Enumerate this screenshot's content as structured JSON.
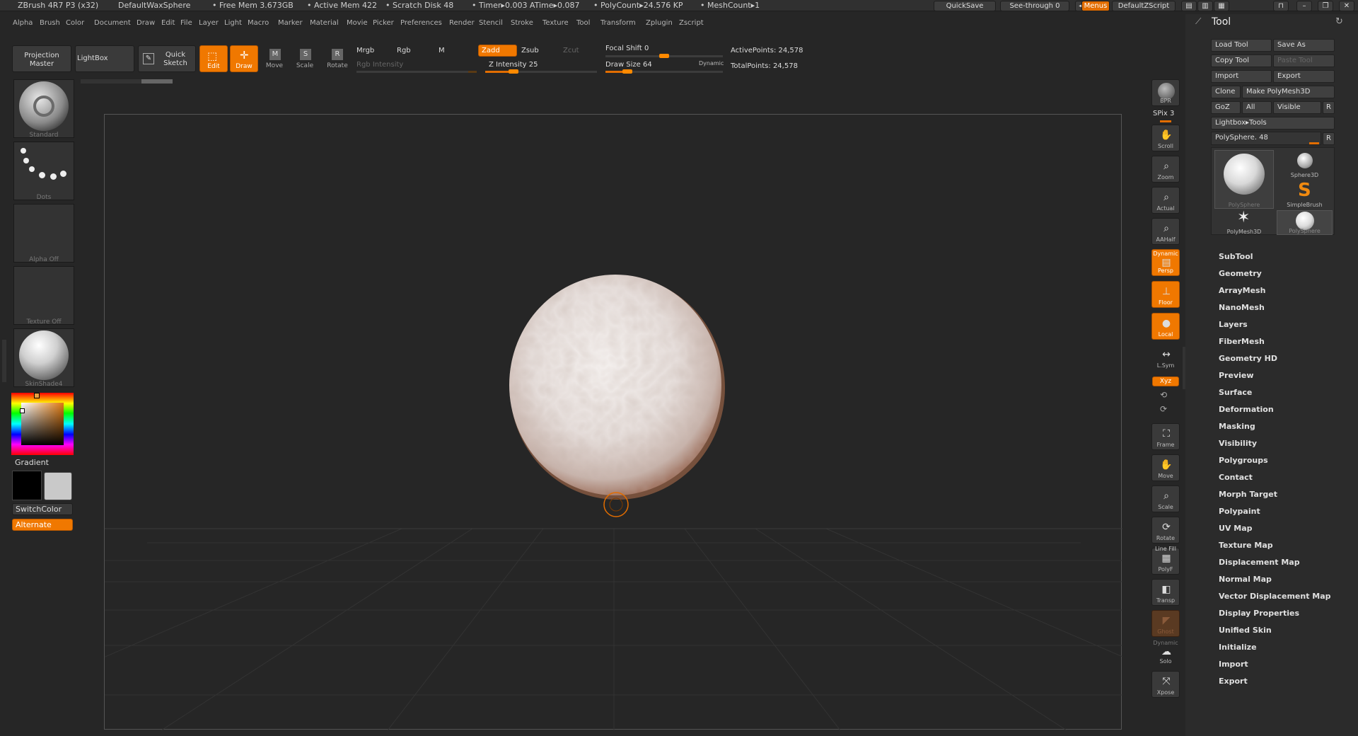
{
  "titlebar": {
    "app": "ZBrush 4R7 P3 (x32)",
    "doc": "DefaultWaxSphere",
    "free_mem": "• Free Mem 3.673GB",
    "active_mem": "• Active Mem 422",
    "scratch": "• Scratch Disk 48",
    "timer": "• Timer▸0.003 ATime▸0.087",
    "polycount": "• PolyCount▸24.576 KP",
    "meshcount": "• MeshCount▸1",
    "quicksave": "QuickSave",
    "seethrough": "See-through  0",
    "menus": "Menus",
    "script": "DefaultZScript"
  },
  "menubar": [
    "Alpha",
    "Brush",
    "Color",
    "Document",
    "Draw",
    "Edit",
    "File",
    "Layer",
    "Light",
    "Macro",
    "Marker",
    "Material",
    "Movie",
    "Picker",
    "Preferences",
    "Render",
    "Stencil",
    "Stroke",
    "Texture",
    "Tool",
    "Transform",
    "Zplugin",
    "Zscript"
  ],
  "shelf": {
    "projection_master": "Projection Master",
    "lightbox": "LightBox",
    "quick_sketch": "Quick Sketch",
    "edit": "Edit",
    "draw": "Draw",
    "move": "Move",
    "scale": "Scale",
    "rotate": "Rotate",
    "mrgb": "Mrgb",
    "rgb": "Rgb",
    "m": "M",
    "rgb_intensity": "Rgb Intensity",
    "zadd": "Zadd",
    "zsub": "Zsub",
    "zcut": "Zcut",
    "z_intensity": "Z Intensity 25",
    "focal_shift": "Focal Shift 0",
    "draw_size": "Draw Size 64",
    "dynamic": "Dynamic",
    "active_points": "ActivePoints: 24,578",
    "total_points": "TotalPoints: 24,578",
    "z_intensity_value": 25,
    "focal_shift_value": 0,
    "draw_size_value": 64
  },
  "left": {
    "brush": "Standard",
    "stroke": "Dots",
    "alpha": "Alpha  Off",
    "texture": "Texture  Off",
    "material": "SkinShade4",
    "gradient": "Gradient",
    "switch_color": "SwitchColor",
    "alternate": "Alternate"
  },
  "rightbar": {
    "bpr": "BPR",
    "spix": "SPix 3",
    "scroll": "Scroll",
    "zoom": "Zoom",
    "actual": "Actual",
    "aahalf": "AAHalf",
    "dynamic": "Dynamic",
    "persp": "Persp",
    "floor": "Floor",
    "local": "Local",
    "lsym": "L.Sym",
    "xyz": "Xyz",
    "frame": "Frame",
    "move": "Move",
    "scale": "Scale",
    "rotate": "Rotate",
    "linefill": "Line Fill",
    "polyf": "PolyF",
    "transp": "Transp",
    "ghost": "Ghost",
    "dynamic2": "Dynamic",
    "solo": "Solo",
    "xpose": "Xpose"
  },
  "tool": {
    "title": "Tool",
    "load_tool": "Load Tool",
    "save_as": "Save As",
    "copy_tool": "Copy Tool",
    "paste_tool": "Paste Tool",
    "import": "Import",
    "export": "Export",
    "clone": "Clone",
    "make_polymesh": "Make PolyMesh3D",
    "goz": "GoZ",
    "all": "All",
    "visible": "Visible",
    "r": "R",
    "lightbox_tools": "Lightbox▸Tools",
    "current_tool": "PolySphere. 48",
    "r2": "R",
    "thumbs": {
      "big": "PolySphere",
      "sphere3d": "Sphere3D",
      "simplebrush": "SimpleBrush",
      "polymesh3d": "PolyMesh3D",
      "polysphere": "PolySphere"
    },
    "sections": [
      "SubTool",
      "Geometry",
      "ArrayMesh",
      "NanoMesh",
      "Layers",
      "FiberMesh",
      "Geometry HD",
      "Preview",
      "Surface",
      "Deformation",
      "Masking",
      "Visibility",
      "Polygroups",
      "Contact",
      "Morph Target",
      "Polypaint",
      "UV Map",
      "Texture Map",
      "Displacement Map",
      "Normal Map",
      "Vector Displacement Map",
      "Display Properties",
      "Unified Skin",
      "Initialize",
      "Import",
      "Export"
    ]
  },
  "colors": {
    "accent": "#f07800",
    "bg": "#262626",
    "panel": "#2b2b2b"
  }
}
